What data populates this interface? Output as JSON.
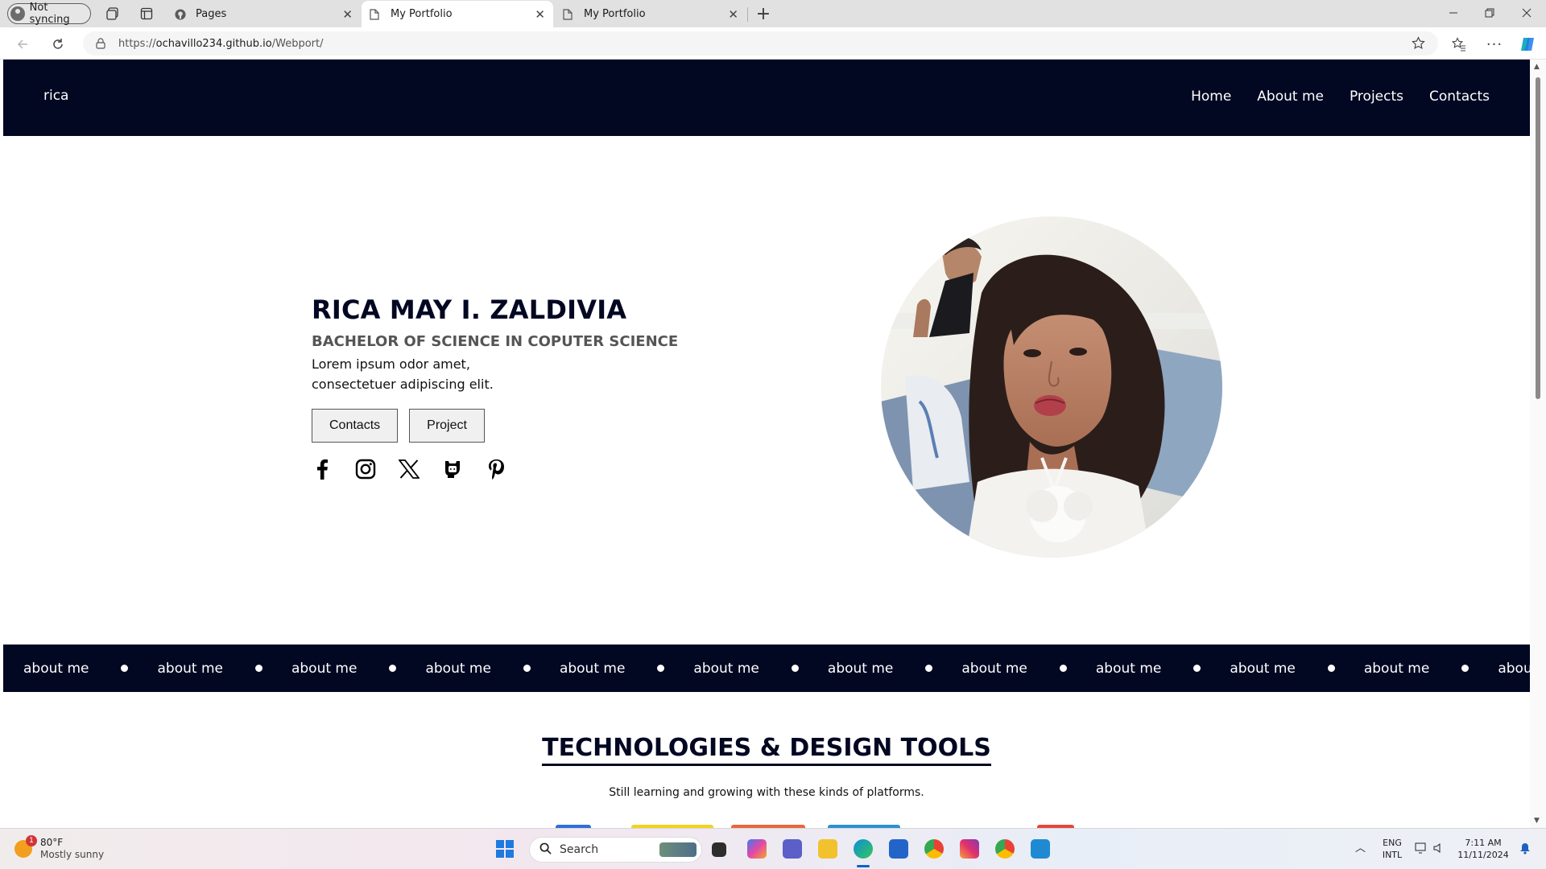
{
  "browser": {
    "profile_label": "Not syncing",
    "tabs": [
      {
        "title": "Pages"
      },
      {
        "title": "My Portfolio"
      },
      {
        "title": "My Portfolio"
      }
    ],
    "url": {
      "prefix": "https://",
      "host": "ochavillo234.github.io",
      "path": "/Webport/"
    }
  },
  "site": {
    "brand": "rica",
    "nav": [
      "Home",
      "About me",
      "Projects",
      "Contacts"
    ],
    "hero": {
      "name": "RICA MAY I. ZALDIVIA",
      "subtitle": "BACHELOR OF SCIENCE IN COPUTER SCIENCE",
      "desc_line1": "Lorem ipsum odor amet,",
      "desc_line2": "consectetuer adipiscing elit.",
      "buttons": [
        "Contacts",
        "Project"
      ],
      "socials": [
        "facebook-icon",
        "instagram-icon",
        "x-twitter-icon",
        "github-icon",
        "pinterest-icon"
      ]
    },
    "ticker": [
      "about me",
      "about me",
      "about me",
      "about me",
      "about me",
      "about me",
      "about me",
      "about me",
      "about me",
      "about me",
      "about me",
      "about me"
    ],
    "tech": {
      "title": "TECHNOLOGIES & DESIGN TOOLS",
      "subtitle": "Still learning and growing with these kinds of platforms."
    }
  },
  "taskbar": {
    "weather_temp": "80°F",
    "weather_cond": "Mostly sunny",
    "weather_badge": "1",
    "search_placeholder": "Search",
    "lang_top": "ENG",
    "lang_bottom": "INTL",
    "time": "7:11 AM",
    "date": "11/11/2024"
  },
  "colors": {
    "navy": "#020722",
    "accent": "#0a62c7"
  }
}
